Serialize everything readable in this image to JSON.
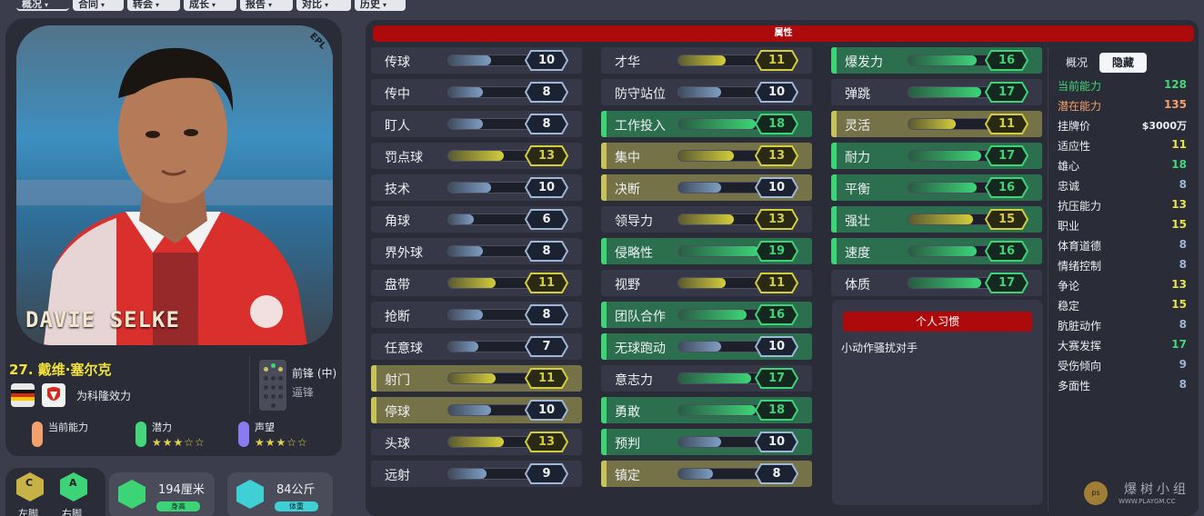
{
  "tabs": [
    {
      "label": "概况",
      "active": true
    },
    {
      "label": "合同",
      "active": false
    },
    {
      "label": "转会",
      "active": false
    },
    {
      "label": "成长",
      "active": false
    },
    {
      "label": "报告",
      "active": false
    },
    {
      "label": "对比",
      "active": false
    },
    {
      "label": "历史",
      "active": false
    }
  ],
  "player": {
    "photo_tag": "EPL",
    "shirt_name": "DAVIE SELKE",
    "name": "27. 戴维·塞尔克",
    "club": "为科隆效力",
    "position_main": "前锋 (中)",
    "position_sub": "逼锋",
    "ratings": [
      {
        "label": "当前能力",
        "color": "#f2a06c",
        "stars": null
      },
      {
        "label": "潜力",
        "color": "#44d67a",
        "stars": "★★★☆☆"
      },
      {
        "label": "声望",
        "color": "#8a7cf0",
        "stars": "★★★☆☆"
      }
    ],
    "foot_left": "左脚",
    "foot_right": "右脚",
    "foot_left_badge": "C",
    "foot_right_badge": "A",
    "height": "194厘米",
    "height_label": "身高",
    "weight": "84公斤",
    "weight_label": "体重"
  },
  "attributes": {
    "header": "属性",
    "col1": [
      {
        "label": "传球",
        "value": 10,
        "hl": ""
      },
      {
        "label": "传中",
        "value": 8,
        "hl": ""
      },
      {
        "label": "盯人",
        "value": 8,
        "hl": ""
      },
      {
        "label": "罚点球",
        "value": 13,
        "hl": ""
      },
      {
        "label": "技术",
        "value": 10,
        "hl": ""
      },
      {
        "label": "角球",
        "value": 6,
        "hl": ""
      },
      {
        "label": "界外球",
        "value": 8,
        "hl": ""
      },
      {
        "label": "盘带",
        "value": 11,
        "hl": ""
      },
      {
        "label": "抢断",
        "value": 8,
        "hl": ""
      },
      {
        "label": "任意球",
        "value": 7,
        "hl": ""
      },
      {
        "label": "射门",
        "value": 11,
        "hl": "y"
      },
      {
        "label": "停球",
        "value": 10,
        "hl": "y"
      },
      {
        "label": "头球",
        "value": 13,
        "hl": ""
      },
      {
        "label": "远射",
        "value": 9,
        "hl": ""
      }
    ],
    "col2": [
      {
        "label": "才华",
        "value": 11,
        "hl": ""
      },
      {
        "label": "防守站位",
        "value": 10,
        "hl": ""
      },
      {
        "label": "工作投入",
        "value": 18,
        "hl": "g"
      },
      {
        "label": "集中",
        "value": 13,
        "hl": "y"
      },
      {
        "label": "决断",
        "value": 10,
        "hl": "y"
      },
      {
        "label": "领导力",
        "value": 13,
        "hl": ""
      },
      {
        "label": "侵略性",
        "value": 19,
        "hl": "g"
      },
      {
        "label": "视野",
        "value": 11,
        "hl": ""
      },
      {
        "label": "团队合作",
        "value": 16,
        "hl": "g"
      },
      {
        "label": "无球跑动",
        "value": 10,
        "hl": "g"
      },
      {
        "label": "意志力",
        "value": 17,
        "hl": ""
      },
      {
        "label": "勇敢",
        "value": 18,
        "hl": "g"
      },
      {
        "label": "预判",
        "value": 10,
        "hl": "g"
      },
      {
        "label": "镇定",
        "value": 8,
        "hl": "y"
      }
    ],
    "col3": [
      {
        "label": "爆发力",
        "value": 16,
        "hl": "g"
      },
      {
        "label": "弹跳",
        "value": 17,
        "hl": ""
      },
      {
        "label": "灵活",
        "value": 11,
        "hl": "y"
      },
      {
        "label": "耐力",
        "value": 17,
        "hl": "g"
      },
      {
        "label": "平衡",
        "value": 16,
        "hl": "g"
      },
      {
        "label": "强壮",
        "value": 15,
        "hl": "g"
      },
      {
        "label": "速度",
        "value": 16,
        "hl": "g"
      },
      {
        "label": "体质",
        "value": 17,
        "hl": ""
      }
    ]
  },
  "habits": {
    "header": "个人习惯",
    "text": "小动作骚扰对手"
  },
  "side": {
    "tab_overview": "概况",
    "tab_hidden": "隐藏",
    "items": [
      {
        "label": "当前能力",
        "value": "128",
        "lcolor": "#44d67a",
        "vcolor": "#44d67a"
      },
      {
        "label": "潜在能力",
        "value": "135",
        "lcolor": "#f2a06c",
        "vcolor": "#f2a06c"
      },
      {
        "label": "挂牌价",
        "value": "$3000万",
        "lcolor": "#eef0f4",
        "vcolor": "#eef0f4"
      },
      {
        "label": "适应性",
        "value": "11",
        "lcolor": "#eef0f4",
        "vcolor": "#e6e34a"
      },
      {
        "label": "雄心",
        "value": "18",
        "lcolor": "#eef0f4",
        "vcolor": "#44d67a"
      },
      {
        "label": "忠诚",
        "value": "8",
        "lcolor": "#eef0f4",
        "vcolor": "#9fb6d6"
      },
      {
        "label": "抗压能力",
        "value": "13",
        "lcolor": "#eef0f4",
        "vcolor": "#e6e34a"
      },
      {
        "label": "职业",
        "value": "15",
        "lcolor": "#eef0f4",
        "vcolor": "#e6e34a"
      },
      {
        "label": "体育道德",
        "value": "8",
        "lcolor": "#eef0f4",
        "vcolor": "#9fb6d6"
      },
      {
        "label": "情绪控制",
        "value": "8",
        "lcolor": "#eef0f4",
        "vcolor": "#9fb6d6"
      },
      {
        "label": "争论",
        "value": "13",
        "lcolor": "#eef0f4",
        "vcolor": "#e6e34a"
      },
      {
        "label": "稳定",
        "value": "15",
        "lcolor": "#eef0f4",
        "vcolor": "#e6e34a"
      },
      {
        "label": "肮脏动作",
        "value": "8",
        "lcolor": "#eef0f4",
        "vcolor": "#9fb6d6"
      },
      {
        "label": "大赛发挥",
        "value": "17",
        "lcolor": "#eef0f4",
        "vcolor": "#44d67a"
      },
      {
        "label": "受伤倾向",
        "value": "9",
        "lcolor": "#eef0f4",
        "vcolor": "#9fb6d6"
      },
      {
        "label": "多面性",
        "value": "8",
        "lcolor": "#eef0f4",
        "vcolor": "#9fb6d6"
      }
    ]
  },
  "watermark": {
    "title": "爆树小组",
    "url": "WWW.PLAYGM.CC",
    "logo": "ps"
  }
}
